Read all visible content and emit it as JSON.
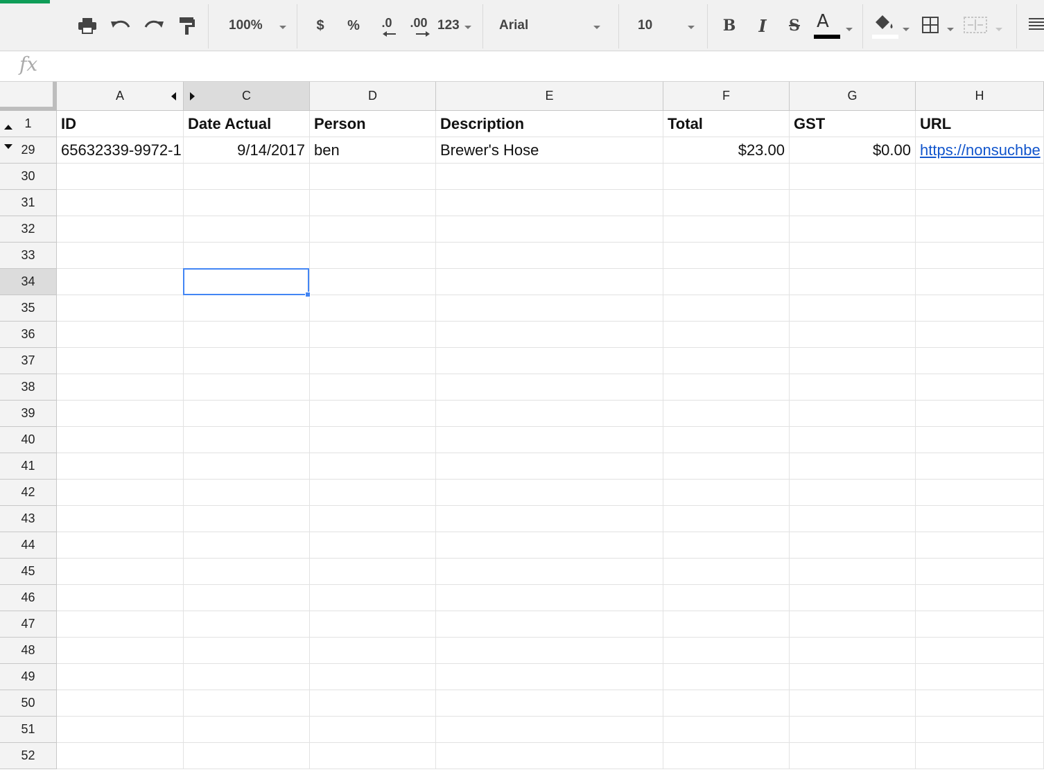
{
  "toolbar": {
    "zoom": "100%",
    "currency": "$",
    "percent": "%",
    "decrease_decimal": ".0",
    "increase_decimal": ".00",
    "more_formats": "123",
    "font": "Arial",
    "font_size": "10",
    "bold": "B",
    "italic": "I",
    "strikethrough": "S",
    "text_color": "A",
    "icons": [
      "print-icon",
      "undo-icon",
      "redo-icon",
      "paint-format-icon",
      "fill-color-icon",
      "borders-icon",
      "merge-cells-icon",
      "align-icon"
    ]
  },
  "formula_bar": {
    "fx_label": "fx",
    "value": ""
  },
  "columns": [
    "A",
    "C",
    "D",
    "E",
    "F",
    "G",
    "H"
  ],
  "header_row": {
    "row_number": "1",
    "cells": [
      "ID",
      "Date Actual",
      "Person",
      "Description",
      "Total",
      "GST",
      "URL"
    ]
  },
  "data_rows": [
    {
      "row_number": "29",
      "cells": [
        "65632339-9972-1",
        "9/14/2017",
        "ben",
        "Brewer's Hose",
        "$23.00",
        "$0.00",
        "https://nonsuchbe"
      ]
    }
  ],
  "empty_rows": [
    "30",
    "31",
    "32",
    "33",
    "34",
    "35",
    "36",
    "37",
    "38",
    "39",
    "40",
    "41",
    "42",
    "43",
    "44",
    "45",
    "46",
    "47",
    "48",
    "49",
    "50",
    "51",
    "52"
  ],
  "selected_cell": "C34",
  "colors": {
    "accent": "#4285f4",
    "link": "#1155cc",
    "brand_green": "#0f9d58"
  }
}
